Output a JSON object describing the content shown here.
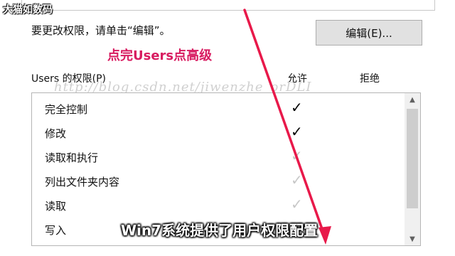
{
  "brand_text": "大猫如数码",
  "instruction": "要更改权限，请单击“编辑”。",
  "edit_button_label": "编辑(E)...",
  "annotation": "点完Users点高级",
  "permissions_header": "Users 的权限(P)",
  "columns": {
    "allow": "允许",
    "deny": "拒绝"
  },
  "watermark": "http://blog.csdn.net/jiwenzhe_orDLI",
  "permissions": [
    {
      "label": "完全控制",
      "allow": true,
      "allow_style": "checked"
    },
    {
      "label": "修改",
      "allow": true,
      "allow_style": "checked"
    },
    {
      "label": "读取和执行",
      "allow": true,
      "allow_style": "inherited"
    },
    {
      "label": "列出文件夹内容",
      "allow": true,
      "allow_style": "inherited"
    },
    {
      "label": "读取",
      "allow": true,
      "allow_style": "inherited"
    },
    {
      "label": "写入",
      "allow": false,
      "allow_style": "none"
    }
  ],
  "caption": "Win7系统提供了用户权限配置",
  "colors": {
    "annotation": "#d81b60",
    "arrow": "#e8194a",
    "checked": "#000000",
    "inherited": "#c8c8c8"
  },
  "icons": {
    "check": "check-icon",
    "scroll_up": "chevron-up-icon",
    "scroll_down": "chevron-down-icon"
  }
}
